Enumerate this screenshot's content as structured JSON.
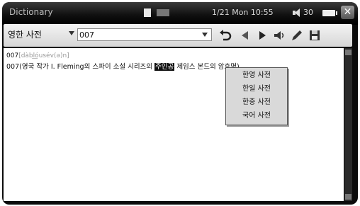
{
  "statusbar": {
    "app_title": "Dictionary",
    "datetime": "1/21 Mon 10:55",
    "volume": "30",
    "close_label": "✕"
  },
  "toolbar": {
    "dictionary_selected": "영한 사전",
    "search_value": "007",
    "icons": [
      "undo-icon",
      "prev-icon",
      "play-icon",
      "speaker-icon",
      "pen-icon",
      "save-icon"
    ]
  },
  "content": {
    "headword": "007",
    "headword_phonetic": "[dàbl͟óusév(ə)n]",
    "definition_before": "007(영국 작가 I. Fleming의 스파이 소설 시리즈의 ",
    "definition_selected": "주인공",
    "definition_after": " 제임스 본드의 암호명)"
  },
  "popup": {
    "items": [
      "한영 사전",
      "한일 사전",
      "한중 사전",
      "국어 사전"
    ]
  }
}
